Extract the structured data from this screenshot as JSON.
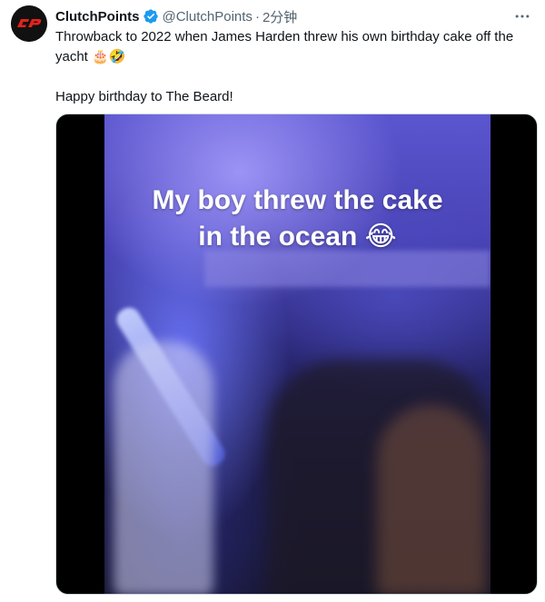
{
  "author": {
    "name": "ClutchPoints",
    "handle": "@ClutchPoints",
    "separator": "·",
    "time": "2分钟",
    "avatar_text": "CP",
    "verified_color": "#1d9bf0"
  },
  "tweet": {
    "line1": "Throwback to 2022 when James Harden threw his own birthday cake off the yacht 🎂🤣",
    "line2": "Happy birthday to The Beard!"
  },
  "media": {
    "caption": "My boy threw the cake in the ocean 😂"
  },
  "colors": {
    "avatar_bg": "#111111",
    "avatar_accent": "#e2231a",
    "text_secondary": "#536471"
  },
  "icons": [
    "verified-badge-icon",
    "more-options-icon"
  ]
}
